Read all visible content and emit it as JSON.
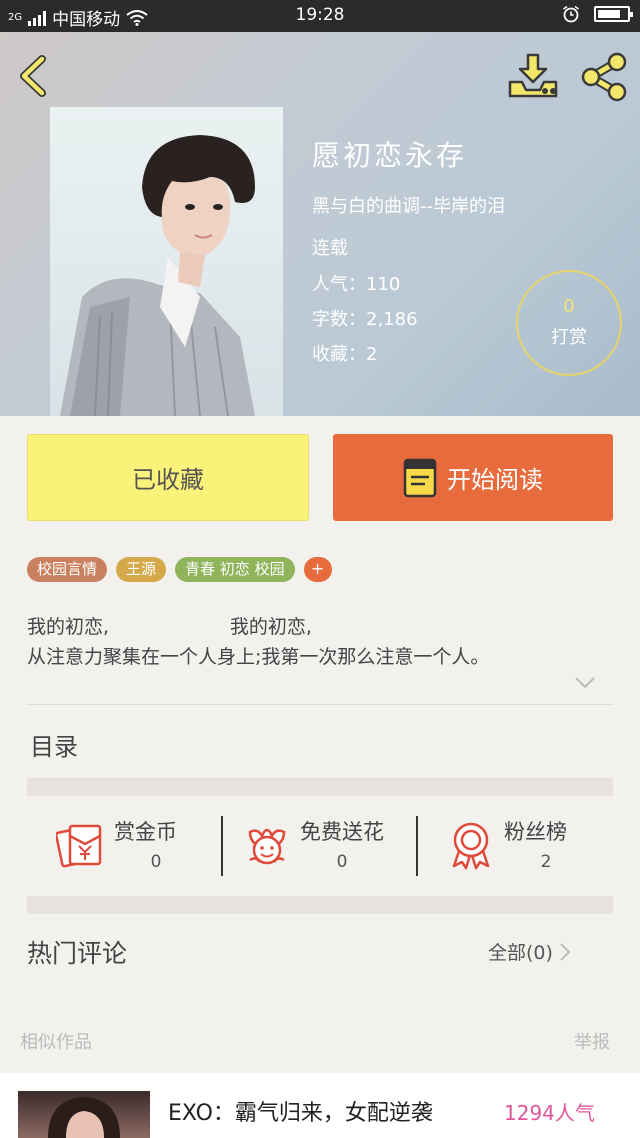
{
  "status_bar": {
    "network": "2G",
    "carrier": "中国移动",
    "time": "19:28"
  },
  "header": {
    "book_title": "愿初恋永存",
    "author": "黑与白的曲调--毕岸的泪",
    "status": "连载",
    "popularity": "人气：110",
    "word_count": "字数：2,186",
    "collections": "收藏：2",
    "tip": {
      "count": "0",
      "label": "打赏"
    }
  },
  "actions": {
    "collected_label": "已收藏",
    "read_label": "开始阅读"
  },
  "tags": [
    {
      "label": "校园言情",
      "color": "#c9805f"
    },
    {
      "label": "王源",
      "color": "#d5a84a"
    },
    {
      "label": "青春 初恋 校园",
      "color": "#8fb45a"
    }
  ],
  "tag_more": "+",
  "intro": {
    "line1": "我的初恋,                    我的初恋,",
    "line2": "从注意力聚集在一个人身上;我第一次那么注意一个人。"
  },
  "toc_label": "目录",
  "stats": [
    {
      "label": "赏金币",
      "value": "0",
      "icon": "red-envelope-icon"
    },
    {
      "label": "免费送花",
      "value": "0",
      "icon": "flower-icon"
    },
    {
      "label": "粉丝榜",
      "value": "2",
      "icon": "award-ribbon-icon"
    }
  ],
  "comments": {
    "title": "热门评论",
    "all_label": "全部(0)"
  },
  "footer": {
    "similar_label": "相似作品",
    "report_label": "举报"
  },
  "recommendation": {
    "title": "EXO：霸气归来，女配逆袭",
    "popularity": "1294人气"
  },
  "colors": {
    "accent_orange": "#e76b3c",
    "collect_yellow": "#fbf27a",
    "icon_yellow": "#f2e76a",
    "stat_red": "#e04a3a",
    "popularity_pink": "#e0569a"
  }
}
